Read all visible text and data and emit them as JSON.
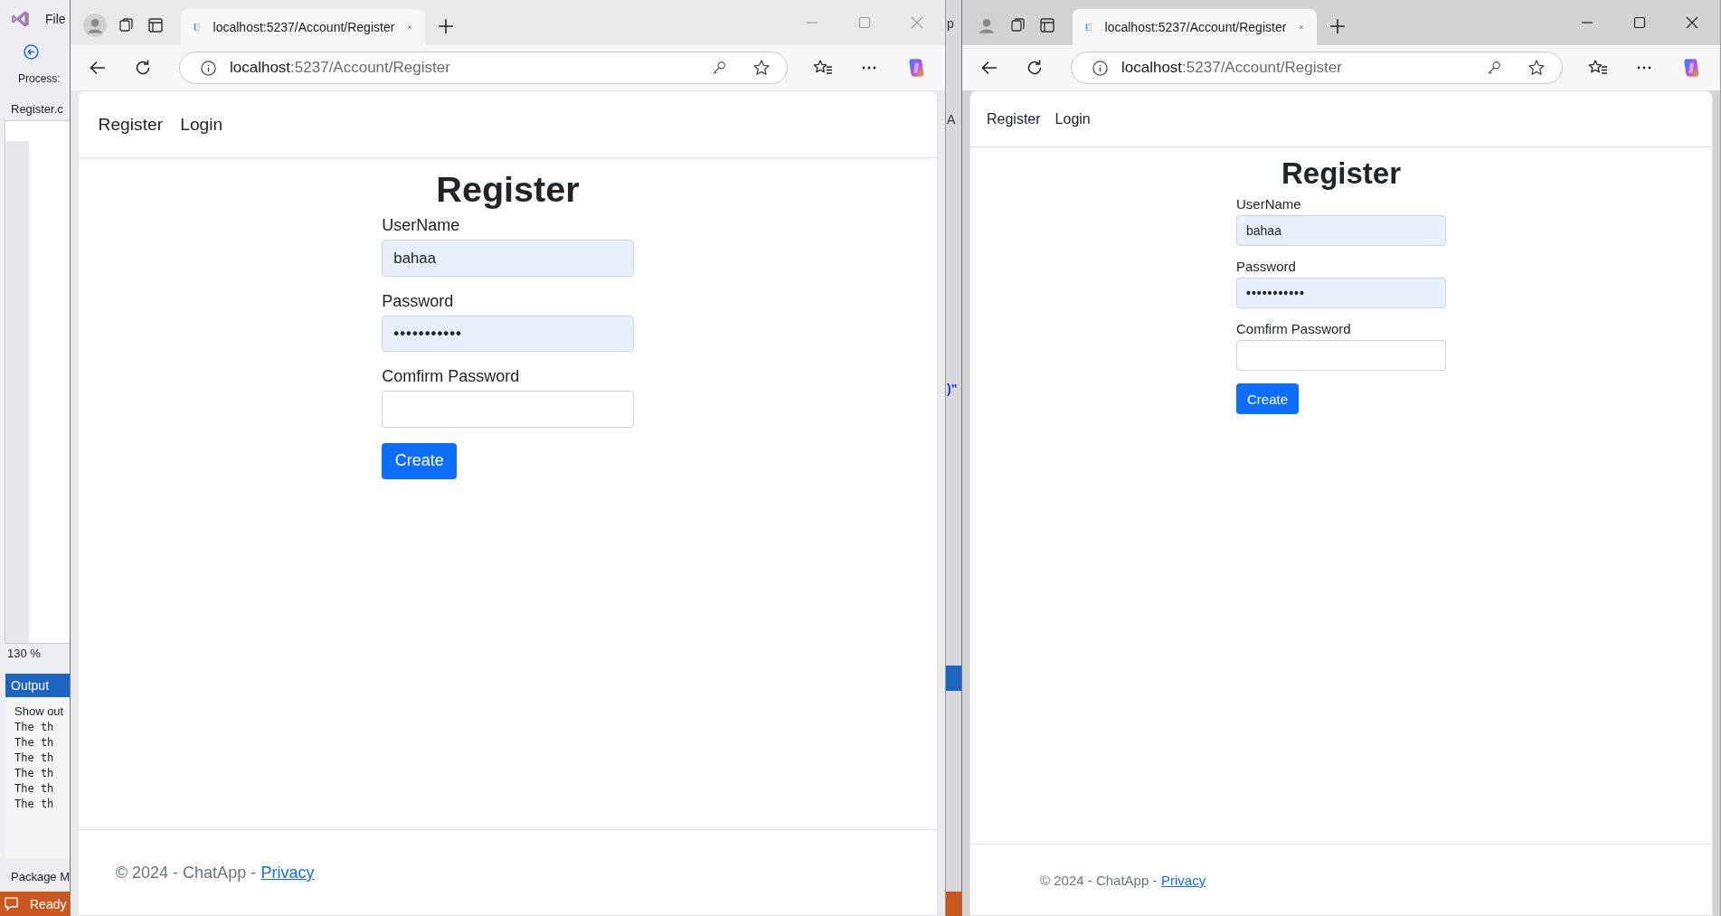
{
  "vs_panel": {
    "menu": "File",
    "toolbar_label": "Process:",
    "doc_tab": "Register.c",
    "zoom": "130 %",
    "output_title": "Output",
    "output_header": "Show out",
    "output_lines": [
      "The th",
      "The th",
      "The th",
      "The th",
      "The th",
      "The th"
    ],
    "bottom_tab": "Package M",
    "status": "Ready",
    "edge_texts": [
      "p",
      "A",
      ")\""
    ]
  },
  "browsers": [
    {
      "active": false,
      "kind": "zoomed",
      "tab_title": "localhost:5237/Account/Register",
      "address": {
        "host": "localhost",
        "path": ":5237/Account/Register"
      },
      "nav": [
        "Register",
        "Login"
      ],
      "heading": "Register",
      "fields": [
        {
          "label": "UserName",
          "kind": "text",
          "value": "bahaa",
          "autofilled": true
        },
        {
          "label": "Password",
          "kind": "password",
          "value": "•••••••••••",
          "autofilled": true
        },
        {
          "label": "Comfirm Password",
          "kind": "password",
          "autofilled": false
        }
      ],
      "button": "Create",
      "footer": {
        "text": "© 2024 - ChatApp -",
        "link": "Privacy"
      }
    },
    {
      "active": true,
      "kind": "normal",
      "tab_title": "localhost:5237/Account/Register",
      "address": {
        "host": "localhost",
        "path": ":5237/Account/Register"
      },
      "nav": [
        "Register",
        "Login"
      ],
      "heading": "Register",
      "fields": [
        {
          "label": "UserName",
          "kind": "text",
          "value": "bahaa",
          "autofilled": true
        },
        {
          "label": "Password",
          "kind": "password",
          "value": "•••••••••••",
          "autofilled": true
        },
        {
          "label": "Comfirm Password",
          "kind": "password",
          "autofilled": false
        }
      ],
      "button": "Create",
      "footer": {
        "text": "© 2024 - ChatApp -",
        "link": "Privacy"
      }
    }
  ]
}
